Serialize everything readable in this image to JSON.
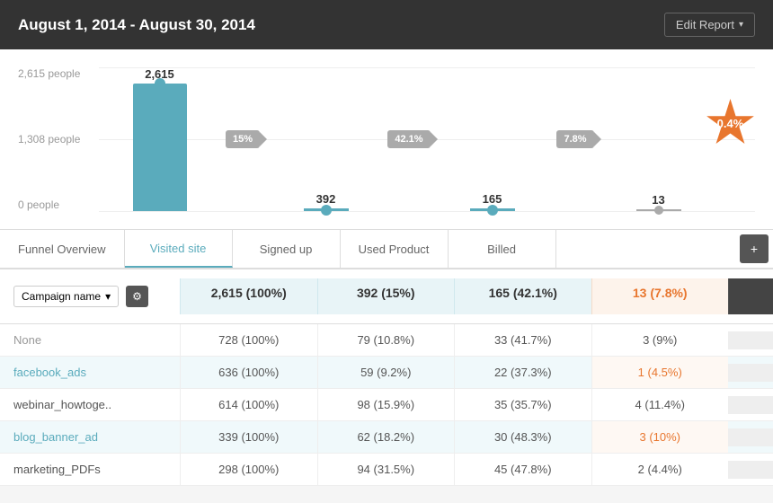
{
  "header": {
    "title": "August 1, 2014 - August 30, 2014",
    "edit_report_label": "Edit Report"
  },
  "chart": {
    "y_axis": [
      "2,615 people",
      "1,308 people",
      "0 people"
    ],
    "bars": [
      {
        "label": "2,615",
        "height": 160,
        "type": "main"
      },
      {
        "label": "392",
        "height": 24,
        "type": "small"
      },
      {
        "label": "165",
        "height": 10,
        "type": "small"
      },
      {
        "label": "13",
        "height": 6,
        "type": "line"
      }
    ],
    "arrows": [
      {
        "label": "15%"
      },
      {
        "label": "42.1%"
      },
      {
        "label": "7.8%"
      }
    ],
    "badge": {
      "label": "0.4%"
    }
  },
  "tabs": [
    {
      "label": "Funnel Overview",
      "active": false
    },
    {
      "label": "Visited site",
      "active": true
    },
    {
      "label": "Signed up",
      "active": false
    },
    {
      "label": "Used Product",
      "active": false
    },
    {
      "label": "Billed",
      "active": false
    }
  ],
  "table": {
    "group_label": "Campaign name",
    "headers": [
      "2,615 (100%)",
      "392 (15%)",
      "165 (42.1%)",
      "13 (7.8%)"
    ],
    "rows": [
      {
        "label": "None",
        "label_type": "none",
        "cells": [
          "728 (100%)",
          "79 (10.8%)",
          "33 (41.7%)",
          "3 (9%)"
        ]
      },
      {
        "label": "facebook_ads",
        "label_type": "blue",
        "cells": [
          "636 (100%)",
          "59 (9.2%)",
          "22 (37.3%)",
          "1 (4.5%)"
        ],
        "highlight": true
      },
      {
        "label": "webinar_howtoge..",
        "label_type": "normal",
        "cells": [
          "614 (100%)",
          "98 (15.9%)",
          "35 (35.7%)",
          "4 (11.4%)"
        ]
      },
      {
        "label": "blog_banner_ad",
        "label_type": "blue",
        "cells": [
          "339 (100%)",
          "62 (18.2%)",
          "30 (48.3%)",
          "3 (10%)"
        ],
        "highlight": true
      },
      {
        "label": "marketing_PDFs",
        "label_type": "normal",
        "cells": [
          "298 (100%)",
          "94 (31.5%)",
          "45 (47.8%)",
          "2 (4.4%)"
        ]
      }
    ]
  },
  "icons": {
    "chevron_down": "▾",
    "gear": "⚙",
    "plus": "+"
  }
}
